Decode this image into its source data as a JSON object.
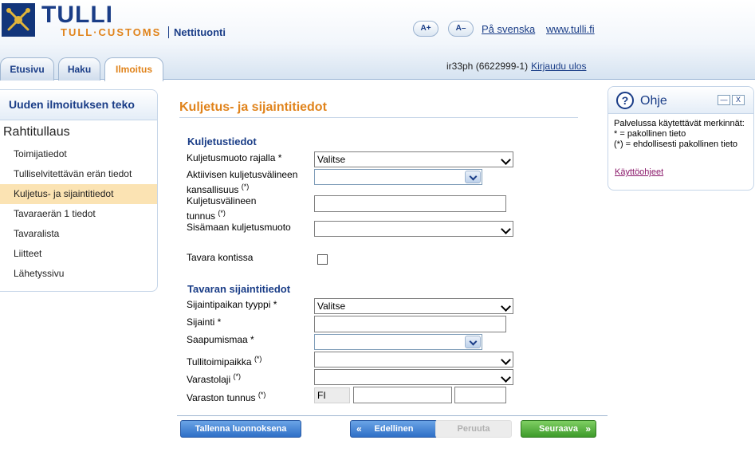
{
  "header": {
    "brand": "TULLI",
    "sub_brand": "TULL·CUSTOMS",
    "service": "Nettituonti",
    "font_larger": "A+",
    "font_smaller": "A–",
    "lang_link": "På svenska",
    "site_link": "www.tulli.fi"
  },
  "tabs": [
    {
      "label": "Etusivu"
    },
    {
      "label": "Haku"
    },
    {
      "label": "Ilmoitus"
    }
  ],
  "user": {
    "id_text": "ir33ph (6622999-1)",
    "logout": "Kirjaudu ulos"
  },
  "sidebar": {
    "heading": "Uuden ilmoituksen teko",
    "group": "Rahtitullaus",
    "items": [
      {
        "label": "Toimijatiedot"
      },
      {
        "label": "Tulliselvitettävän erän tiedot"
      },
      {
        "label": "Kuljetus- ja sijaintitiedot"
      },
      {
        "label": "Tavaraerän 1 tiedot"
      },
      {
        "label": "Tavaralista"
      },
      {
        "label": "Liitteet"
      },
      {
        "label": "Lähetyssivu"
      }
    ]
  },
  "main": {
    "title": "Kuljetus- ja sijaintitiedot",
    "transport_section": "Kuljetustiedot",
    "f_transport_mode": "Kuljetusmuoto rajalla *",
    "f_transport_mode_value": "Valitse",
    "f_nationality_line1": "Aktiivisen kuljetusvälineen",
    "f_nationality_line2": "kansallisuus",
    "f_vehicle_id_line1": "Kuljetusvälineen",
    "f_vehicle_id_line2": "tunnus",
    "f_inland_mode": "Sisämaan kuljetusmuoto",
    "f_container": "Tavara kontissa",
    "location_section": "Tavaran sijaintitiedot",
    "f_location_type": "Sijaintipaikan tyyppi *",
    "f_location_type_value": "Valitse",
    "f_location": "Sijainti *",
    "f_arrival_country": "Saapumismaa *",
    "f_customs_office": "Tullitoimipaikka",
    "f_warehouse_type": "Varastolaji",
    "f_warehouse_id": "Varaston tunnus",
    "warehouse_prefix": "FI",
    "conditional_mark": "(*)"
  },
  "buttons": {
    "save_draft": "Tallenna luonnoksena",
    "previous": "Edellinen",
    "cancel": "Peruuta",
    "next": "Seuraava",
    "prev_arrow": "«",
    "next_arrow": "»"
  },
  "help": {
    "title": "Ohje",
    "icon": "?",
    "minimize": "—",
    "close": "X",
    "line1": "Palvelussa käytettävät merkinnät:",
    "line2": "* = pakollinen tieto",
    "line3": "(*) = ehdollisesti pakollinen tieto",
    "link": "Käyttöohjeet"
  },
  "colors": {
    "brand_blue": "#1a3d87",
    "accent_orange": "#e0831b",
    "active_nav": "#fbe3b3"
  }
}
